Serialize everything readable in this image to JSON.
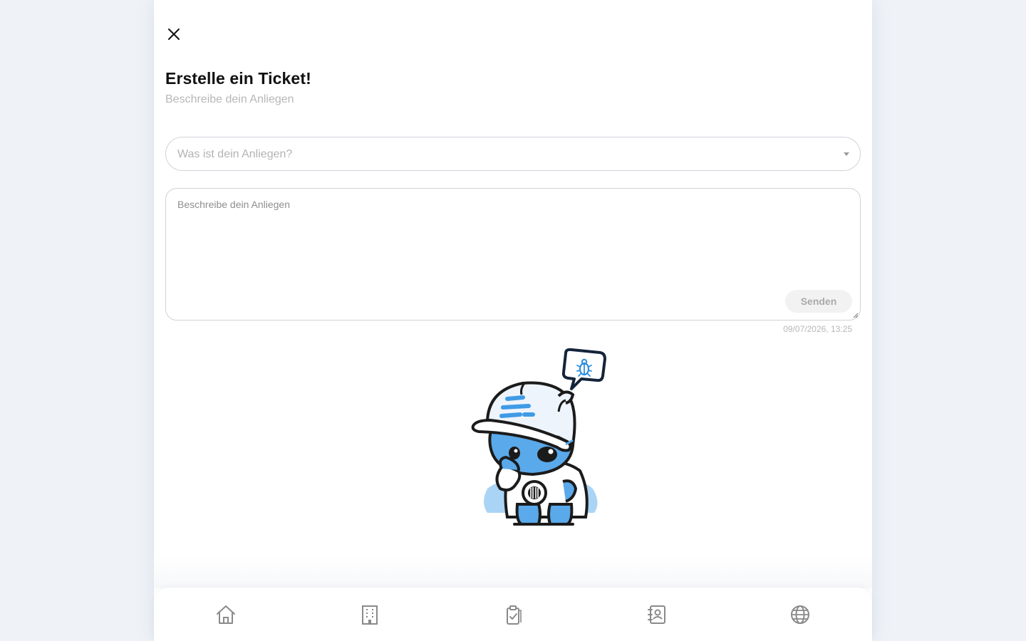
{
  "modal": {
    "title": "Erstelle ein Ticket!",
    "subtitle": "Beschreibe dein Anliegen"
  },
  "form": {
    "category_placeholder": "Was ist dein Anliegen?",
    "description_placeholder": "Beschreibe dein Anliegen",
    "send_label": "Senden",
    "timestamp": "09/07/2026, 13:25"
  },
  "icons": {
    "close": "close-icon",
    "dropdown": "chevron-down-icon",
    "mascot": "mascot-illustration",
    "bug": "bug-icon"
  },
  "bottom_nav": {
    "items": [
      {
        "icon": "home-icon"
      },
      {
        "icon": "building-icon"
      },
      {
        "icon": "clipboard-check-icon"
      },
      {
        "icon": "contacts-book-icon"
      },
      {
        "icon": "globe-icon"
      }
    ]
  },
  "colors": {
    "page_background": "#eff3f8",
    "panel_background": "#ffffff",
    "mascot_blue": "#5aa9ea",
    "mascot_light_blue": "#a9d4f5",
    "outline": "#1b1b1b",
    "muted_text": "#b7b7b7",
    "nav_icon": "#8a8a8a"
  }
}
